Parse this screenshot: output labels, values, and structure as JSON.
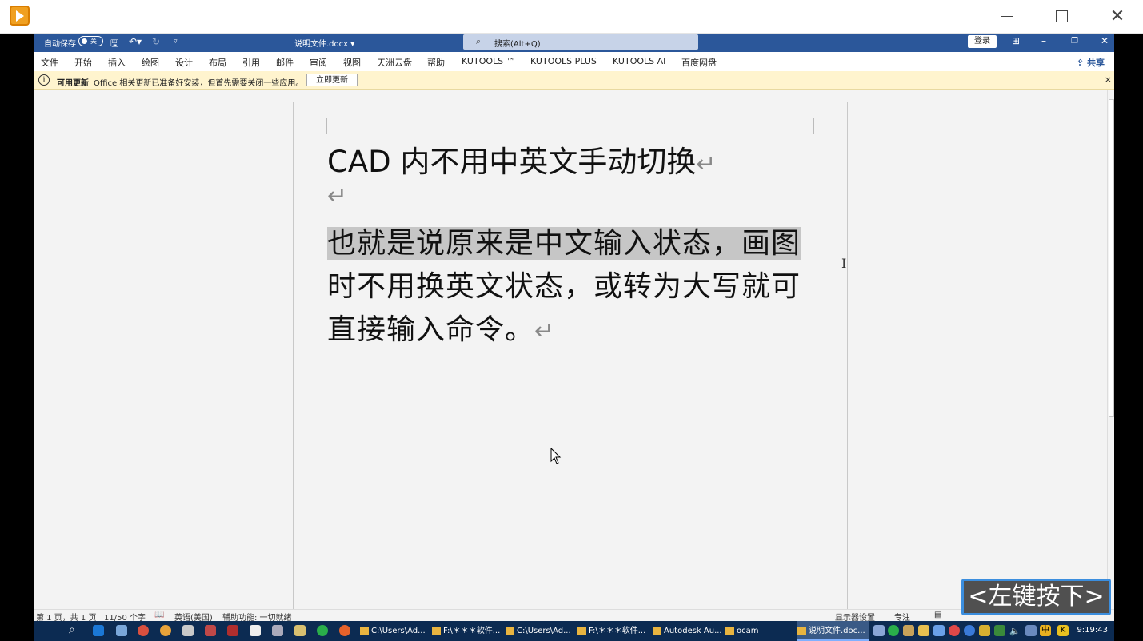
{
  "outer_window": {
    "min_label": "",
    "close_glyph": "✕"
  },
  "word_title": {
    "autosave": "自动保存",
    "toggle": "关",
    "doc_name": "说明文件.docx ▾",
    "search": "搜索(Alt+Q)",
    "login": "登录"
  },
  "ribbon_tabs": [
    "文件",
    "开始",
    "插入",
    "绘图",
    "设计",
    "布局",
    "引用",
    "邮件",
    "审阅",
    "视图",
    "天洲云盘",
    "帮助",
    "KUTOOLS ™",
    "KUTOOLS PLUS",
    "KUTOOLS AI",
    "百度网盘"
  ],
  "share": "共享",
  "msgbar": {
    "title": "可用更新",
    "text": "Office 相关更新已准备好安装，但首先需要关闭一些应用。",
    "button": "立即更新",
    "close": "×"
  },
  "document": {
    "heading": "CAD 内不用中英文手动切换",
    "pilcrow": "↵",
    "body_highlighted": "也就是说原来是中文输入状态，画图",
    "body_rest": "时不用换英文状态，或转为大写就可直接输入命令。"
  },
  "statusbar": {
    "page": "第 1 页，共 1 页",
    "words": "11/50 个字",
    "language": "英语(美国)",
    "accessibility": "辅助功能: 一切就绪",
    "display": "显示器设置",
    "focus": "专注"
  },
  "overlay": "<左键按下>",
  "taskbar": {
    "apps": [
      {
        "label": "C:\\Users\\Ad...",
        "active": false
      },
      {
        "label": "F:\\＊＊＊软件...",
        "active": false
      },
      {
        "label": "C:\\Users\\Ad...",
        "active": false
      },
      {
        "label": "F:\\＊＊＊软件...",
        "active": false
      },
      {
        "label": "Autodesk Au...",
        "active": false
      },
      {
        "label": "ocam",
        "active": false
      },
      {
        "label": "说明文件.doc...",
        "active": true
      }
    ],
    "clock": "9:19:43"
  }
}
